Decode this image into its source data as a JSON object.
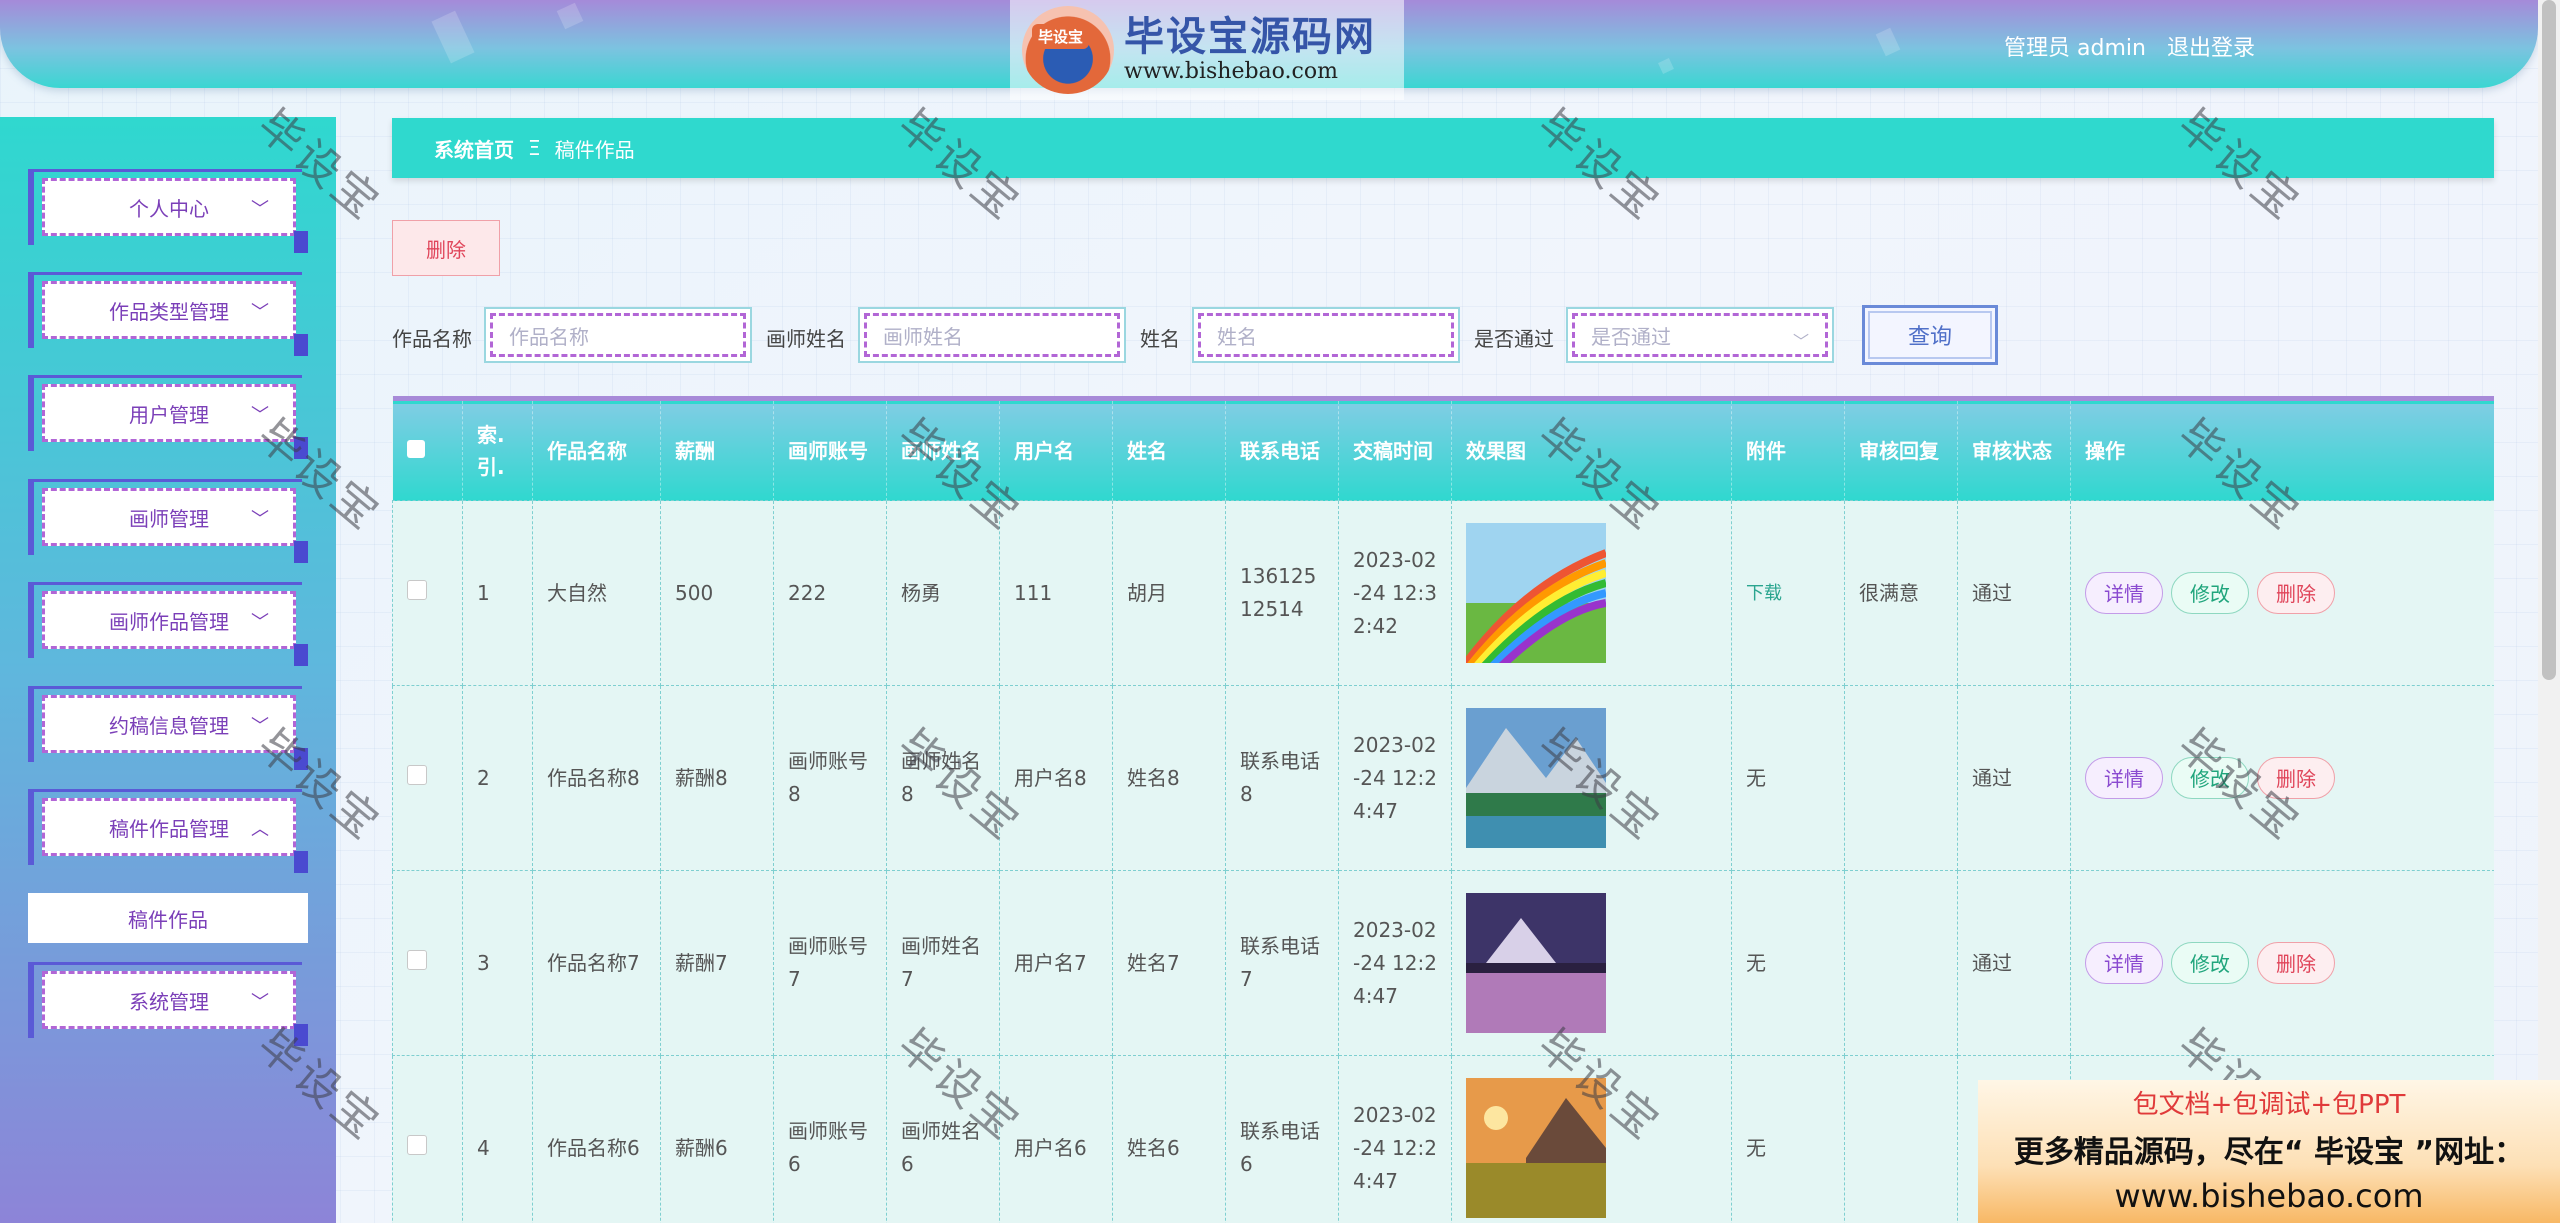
{
  "header": {
    "logo_badge": "毕设宝",
    "logo_title": "毕设宝源码网",
    "logo_url": "www.bishebao.com",
    "user_label": "管理员 admin",
    "logout_label": "退出登录"
  },
  "sidebar": {
    "items": [
      {
        "label": "个人中心",
        "chevron": "﹀"
      },
      {
        "label": "作品类型管理",
        "chevron": "﹀"
      },
      {
        "label": "用户管理",
        "chevron": "﹀"
      },
      {
        "label": "画师管理",
        "chevron": "﹀"
      },
      {
        "label": "画师作品管理",
        "chevron": "﹀"
      },
      {
        "label": "约稿信息管理",
        "chevron": "﹀"
      },
      {
        "label": "稿件作品管理",
        "chevron": "︿"
      },
      {
        "label": "系统管理",
        "chevron": "﹀"
      }
    ],
    "submenu_active": "稿件作品"
  },
  "breadcrumb": {
    "home": "系统首页",
    "separator": "Ξ",
    "current": "稿件作品"
  },
  "toolbar": {
    "delete_label": "删除"
  },
  "filters": {
    "work_name": {
      "label": "作品名称",
      "placeholder": "作品名称"
    },
    "artist_name": {
      "label": "画师姓名",
      "placeholder": "画师姓名"
    },
    "name": {
      "label": "姓名",
      "placeholder": "姓名"
    },
    "approved": {
      "label": "是否通过",
      "placeholder": "是否通过"
    },
    "query_label": "查询"
  },
  "table": {
    "headers": [
      "索引",
      "作品名称",
      "薪酬",
      "画师账号",
      "画师姓名",
      "用户名",
      "姓名",
      "联系电话",
      "交稿时间",
      "效果图",
      "附件",
      "审核回复",
      "审核状态",
      "操作"
    ],
    "headers_display": [
      "索.引.",
      "作品名称",
      "薪酬",
      "画师账号",
      "画师姓名",
      "用户名",
      "姓名",
      "联系电话",
      "交稿时间",
      "效果图",
      "附件",
      "审核回复",
      "审核状态",
      "操作"
    ],
    "actions": {
      "detail": "详情",
      "edit": "修改",
      "delete": "删除"
    },
    "rows": [
      {
        "index": "1",
        "work": "大自然",
        "pay": "500",
        "artist_account": "222",
        "artist_name": "杨勇",
        "username": "111",
        "name": "胡月",
        "phone": "13612512514",
        "time": "2023-02-24 12:32:42",
        "image": "rainbow-road",
        "attachment": "下载",
        "reply": "很满意",
        "status": "通过"
      },
      {
        "index": "2",
        "work": "作品名称8",
        "pay": "薪酬8",
        "artist_account": "画师账号8",
        "artist_name": "画师姓名8",
        "username": "用户名8",
        "name": "姓名8",
        "phone": "联系电话8",
        "time": "2023-02-24 12:24:47",
        "image": "mountain-lake",
        "attachment": "无",
        "reply": "",
        "status": "通过"
      },
      {
        "index": "3",
        "work": "作品名称7",
        "pay": "薪酬7",
        "artist_account": "画师账号7",
        "artist_name": "画师姓名7",
        "username": "用户名7",
        "name": "姓名7",
        "phone": "联系电话7",
        "time": "2023-02-24 12:24:47",
        "image": "purple-lake",
        "attachment": "无",
        "reply": "",
        "status": "通过"
      },
      {
        "index": "4",
        "work": "作品名称6",
        "pay": "薪酬6",
        "artist_account": "画师账号6",
        "artist_name": "画师姓名6",
        "username": "用户名6",
        "name": "姓名6",
        "phone": "联系电话6",
        "time": "2023-02-24 12:24:47",
        "image": "sunset-meadow",
        "attachment": "无",
        "reply": "",
        "status": ""
      }
    ]
  },
  "watermark": "毕设宝",
  "promo": {
    "line1": "包文档+包调试+包PPT",
    "line2": "更多精品源码，尽在“ 毕设宝 ”网址：",
    "line3": "www.bishebao.com"
  },
  "colors": {
    "accent_teal": "#2fd9ce",
    "accent_purple": "#7b3fb8",
    "delete_red": "#e0455a"
  }
}
